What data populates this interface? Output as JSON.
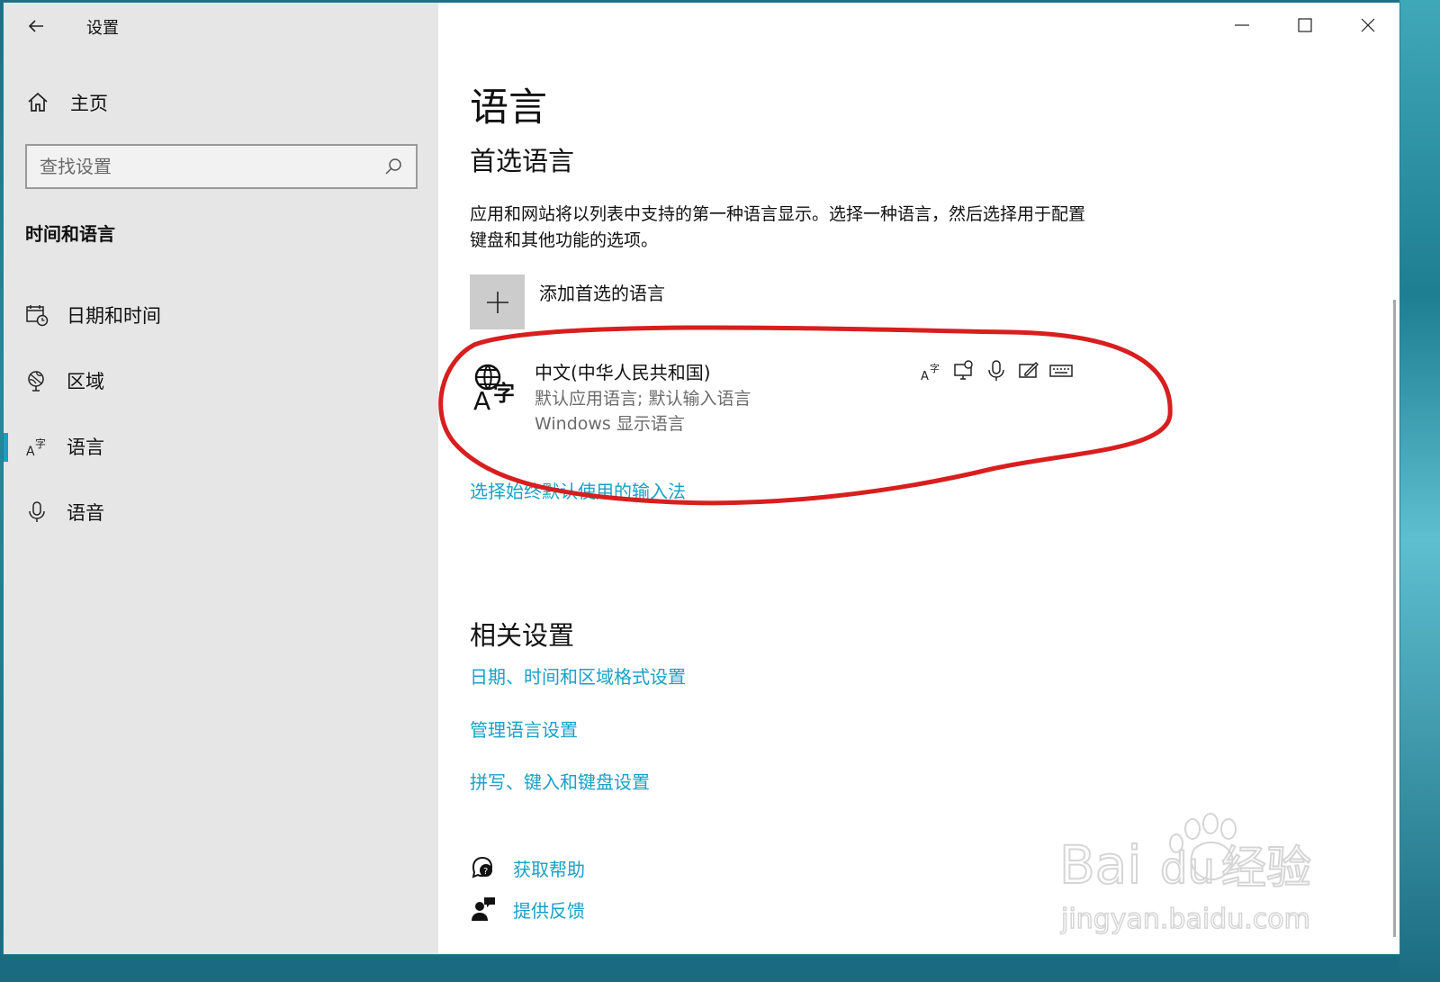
{
  "window": {
    "title": "设置",
    "controls": [
      "minimize",
      "maximize",
      "close"
    ]
  },
  "sidebar": {
    "home_label": "主页",
    "search_placeholder": "查找设置",
    "section_heading": "时间和语言",
    "items": [
      {
        "label": "日期和时间",
        "icon": "calendar-clock-icon",
        "active": false
      },
      {
        "label": "区域",
        "icon": "globe-region-icon",
        "active": false
      },
      {
        "label": "语言",
        "icon": "language-icon",
        "active": true
      },
      {
        "label": "语音",
        "icon": "microphone-icon",
        "active": false
      }
    ]
  },
  "main": {
    "page_title": "语言",
    "preferred_title": "首选语言",
    "description": "应用和网站将以列表中支持的第一种语言显示。选择一种语言，然后选择用于配置键盘和其他功能的选项。",
    "add_language_label": "添加首选的语言",
    "language_entry": {
      "name": "中文(中华人民共和国)",
      "desc1": "默认应用语言; 默认输入语言",
      "desc2": "Windows 显示语言",
      "feature_icons": [
        "display-language-icon",
        "speech-icon",
        "microphone-icon",
        "handwriting-icon",
        "keyboard-icon"
      ]
    },
    "input_method_link": "选择始终默认使用的输入法",
    "related_title": "相关设置",
    "related_links": [
      "日期、时间和区域格式设置",
      "管理语言设置",
      "拼写、键入和键盘设置"
    ],
    "get_help": "获取帮助",
    "feedback": "提供反馈"
  },
  "colors": {
    "accent": "#1aa0c8",
    "sidebar_bg": "#e6e6e6",
    "annotation": "#d81e1e"
  },
  "watermark": {
    "brand": "Bai du 经验",
    "url": "jingyan.baidu.com"
  }
}
